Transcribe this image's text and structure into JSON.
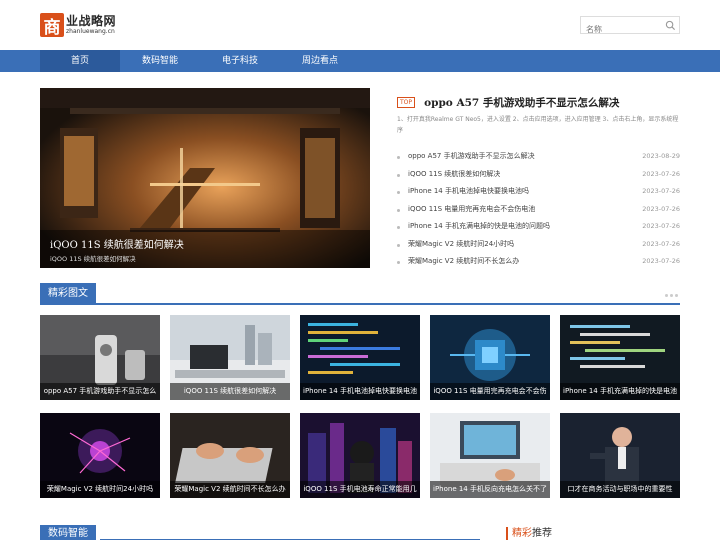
{
  "header": {
    "logo_mark": "商",
    "logo_cn": "业战略网",
    "logo_en": "zhanluewang.cn",
    "search_placeholder": "名称"
  },
  "nav": {
    "items": [
      {
        "label": "首页",
        "active": true
      },
      {
        "label": "数码智能",
        "active": false
      },
      {
        "label": "电子科技",
        "active": false
      },
      {
        "label": "周边看点",
        "active": false
      }
    ]
  },
  "hero": {
    "title": "iQOO 11S 续航很差如何解决",
    "subtitle": "iQOO 11S 续航很差如何解决"
  },
  "top_article": {
    "badge": "TOP",
    "title": "oppo A57 手机游戏助手不显示怎么解决",
    "desc": "1、打开真我Realme GT Neo5，进入设置 2、点击应用选项，进入应用管理 3、点击右上角，显示系统程序"
  },
  "news": [
    {
      "title": "oppo A57 手机游戏助手不显示怎么解决",
      "date": "2023-08-29"
    },
    {
      "title": "iQOO 11S 续航很差如何解决",
      "date": "2023-07-26"
    },
    {
      "title": "iPhone 14 手机电池掉电快要换电池吗",
      "date": "2023-07-26"
    },
    {
      "title": "iQOO 11S 电量用完再充电会不会伤电池",
      "date": "2023-07-26"
    },
    {
      "title": "iPhone 14 手机充满电掉的快是电池的问题吗",
      "date": "2023-07-26"
    },
    {
      "title": "荣耀Magic V2 续航时间24小时吗",
      "date": "2023-07-26"
    },
    {
      "title": "荣耀Magic V2 续航时间不长怎么办",
      "date": "2023-07-26"
    }
  ],
  "featured": {
    "heading": "精彩图文",
    "cards": [
      {
        "caption": "oppo A57 手机游戏助手不显示怎么"
      },
      {
        "caption": "iQOO 11S 续航很差如何解决"
      },
      {
        "caption": "iPhone 14 手机电池掉电快要换电池"
      },
      {
        "caption": "iQOO 11S 电量用完再充电会不会伤"
      },
      {
        "caption": "iPhone 14 手机充满电掉的快是电池"
      },
      {
        "caption": "荣耀Magic V2 续航时间24小时吗"
      },
      {
        "caption": "荣耀Magic V2 续航时间不长怎么办"
      },
      {
        "caption": "iQOO 11S 手机电池寿命正常能用几"
      },
      {
        "caption": "iPhone 14 手机反向充电怎么关不了"
      },
      {
        "caption": "口才在商务活动与职场中的重要性"
      }
    ]
  },
  "bottom": {
    "section_title": "数码智能",
    "rec_hl": "精彩",
    "rec_rest": "推荐"
  },
  "colors": {
    "nav_blue": "#3a6fb7",
    "accent_orange": "#d9501a"
  }
}
